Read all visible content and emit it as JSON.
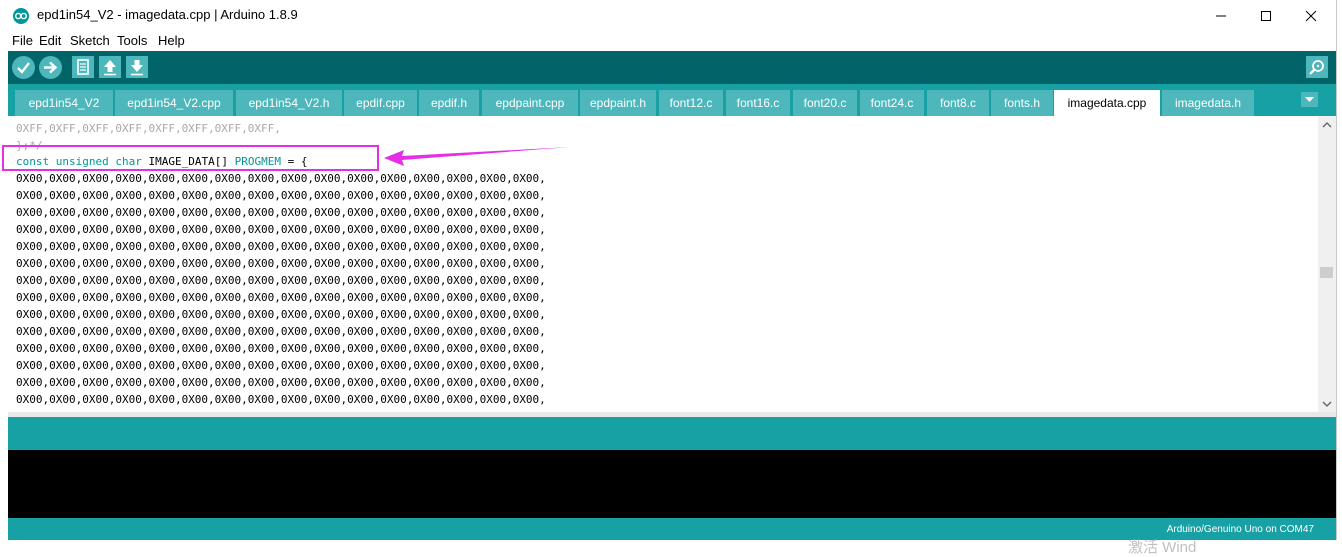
{
  "window": {
    "title": "epd1in54_V2 - imagedata.cpp | Arduino 1.8.9"
  },
  "menu": [
    "File",
    "Edit",
    "Sketch",
    "Tools",
    "Help"
  ],
  "tabs": [
    {
      "label": "epd1in54_V2",
      "active": false
    },
    {
      "label": "epd1in54_V2.cpp",
      "active": false
    },
    {
      "label": "epd1in54_V2.h",
      "active": false
    },
    {
      "label": "epdif.cpp",
      "active": false
    },
    {
      "label": "epdif.h",
      "active": false
    },
    {
      "label": "epdpaint.cpp",
      "active": false
    },
    {
      "label": "epdpaint.h",
      "active": false
    },
    {
      "label": "font12.c",
      "active": false
    },
    {
      "label": "font16.c",
      "active": false
    },
    {
      "label": "font20.c",
      "active": false
    },
    {
      "label": "font24.c",
      "active": false
    },
    {
      "label": "font8.c",
      "active": false
    },
    {
      "label": "fonts.h",
      "active": false
    },
    {
      "label": "imagedata.cpp",
      "active": true
    },
    {
      "label": "imagedata.h",
      "active": false
    }
  ],
  "editor": {
    "line_prev": "0XFF,0XFF,0XFF,0XFF,0XFF,0XFF,0XFF,0XFF,",
    "line_close": "};*/",
    "decl": {
      "kw1": "const",
      "kw2": "unsigned",
      "kw3": "char",
      "name": "IMAGE_DATA[]",
      "macro": "PROGMEM",
      "rest": "= {"
    },
    "data_line": "0X00,0X00,0X00,0X00,0X00,0X00,0X00,0X00,0X00,0X00,0X00,0X00,0X00,0X00,0X00,0X00,",
    "data_line_count": 14
  },
  "status_board": "Arduino/Genuino Uno on COM47",
  "background_text": "激活 Wind",
  "colors": {
    "toolbar": "#006468",
    "tabbar": "#17a1a5",
    "tab": "#4db7bb",
    "highlight": "#e62ee6"
  }
}
